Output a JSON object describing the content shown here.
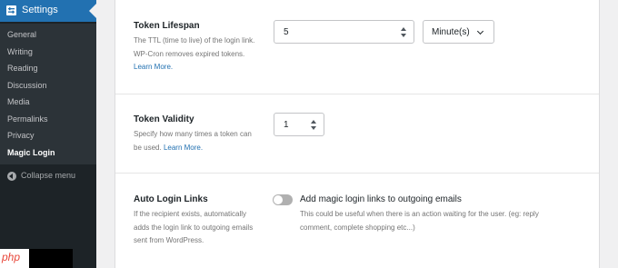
{
  "sidebar": {
    "header_title": "Settings",
    "items": [
      {
        "label": "General"
      },
      {
        "label": "Writing"
      },
      {
        "label": "Reading"
      },
      {
        "label": "Discussion"
      },
      {
        "label": "Media"
      },
      {
        "label": "Permalinks"
      },
      {
        "label": "Privacy"
      },
      {
        "label": "Magic Login"
      }
    ],
    "collapse_label": "Collapse menu",
    "watermark_text": "php"
  },
  "settings": {
    "token_lifespan": {
      "title": "Token Lifespan",
      "desc": "The TTL (time to live) of the login link. WP-Cron removes expired tokens.",
      "link": "Learn More.",
      "value": "5",
      "unit": "Minute(s)"
    },
    "token_validity": {
      "title": "Token Validity",
      "desc": "Specify how many times a token can be used.",
      "link": "Learn More.",
      "value": "1"
    },
    "auto_login_links": {
      "title": "Auto Login Links",
      "desc": "If the recipient exists, automatically adds the login link to outgoing emails sent from WordPress.",
      "toggle_label": "Add magic login links to outgoing emails",
      "toggle_help": "This could be useful when there is an action waiting for the user. (eg: reply comment, complete shopping etc...)",
      "enabled": false
    }
  },
  "colors": {
    "sidebar_bg": "#1d2327",
    "accent": "#2271b1",
    "link": "#2271b1"
  }
}
